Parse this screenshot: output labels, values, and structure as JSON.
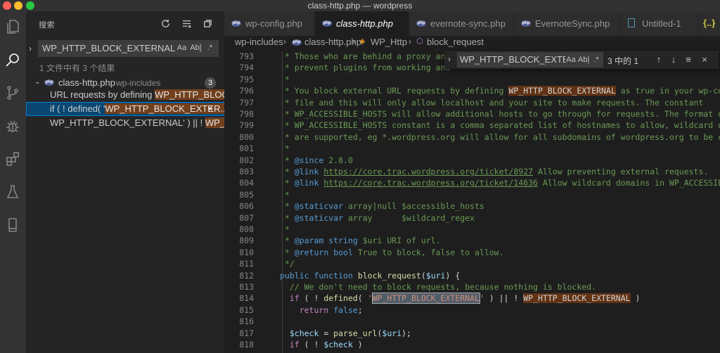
{
  "window": {
    "title": "class-http.php — wordpress"
  },
  "activity_bar": {
    "items": [
      {
        "icon": "files-icon"
      },
      {
        "icon": "search-icon"
      },
      {
        "icon": "source-control-icon"
      },
      {
        "icon": "debug-icon"
      },
      {
        "icon": "extensions-icon"
      },
      {
        "icon": "test-flask-icon"
      },
      {
        "icon": "device-icon"
      }
    ]
  },
  "sidebar": {
    "title": "搜索",
    "search_value": "WP_HTTP_BLOCK_EXTERNAL",
    "search_options": [
      "Aa",
      "Ab|",
      ".*"
    ],
    "result_summary": "1 文件中有 3 个结果",
    "file": {
      "name": "class-http.php",
      "path": "wp-includes",
      "count": "3",
      "badge": "php"
    },
    "matches": [
      {
        "before": "URL requests by defining ",
        "match": "WP_HTTP_BLOCK_...",
        "after": ""
      },
      {
        "before": "if ( ! defined( '",
        "match": "WP_HTTP_BLOCK_EXTER...",
        "after": ""
      },
      {
        "before": "WP_HTTP_BLOCK_EXTERNAL' ) || ! ",
        "match": "WP_HTTP...",
        "after": ""
      }
    ]
  },
  "tabs": [
    {
      "label": "wp-config.php",
      "type": "php"
    },
    {
      "label": "class-http.php",
      "type": "php",
      "active": true
    },
    {
      "label": "evernote-sync.php",
      "type": "php"
    },
    {
      "label": "EvernoteSync.php",
      "type": "php"
    },
    {
      "label": "Untitled-1",
      "type": "file"
    },
    {
      "label": "{..}",
      "type": "json"
    }
  ],
  "breadcrumbs": {
    "folder": "wp-includes",
    "file": "class-http.php",
    "class": "WP_Http",
    "method": "block_request"
  },
  "find_widget": {
    "value": "WP_HTTP_BLOCK_EXTERN/",
    "options": [
      "Aa",
      "Ab|",
      ".*"
    ],
    "count": "3 中的 1",
    "prev": "↑",
    "next": "↓",
    "selection": "≡",
    "close": "×"
  },
  "code": {
    "line_numbers": [
      "793",
      "794",
      "795",
      "796",
      "797",
      "798",
      "799",
      "800",
      "801",
      "802",
      "803",
      "804",
      "805",
      "806",
      "807",
      "808",
      "809",
      "810",
      "811",
      "812",
      "813",
      "814",
      "815",
      "816",
      "817",
      "818"
    ],
    "lines": [
      [
        {
          "c": "cm",
          "t": " * Those who are behind a proxy and "
        }
      ],
      [
        {
          "c": "cm",
          "t": " * prevent plugins from working and "
        }
      ],
      [
        {
          "c": "cm",
          "t": " *"
        }
      ],
      [
        {
          "c": "cm",
          "t": " * You block external URL requests by defining "
        },
        {
          "c": "mh",
          "t": "WP_HTTP_BLOCK_EXTERNAL"
        },
        {
          "c": "cm",
          "t": " as true in your wp-config"
        }
      ],
      [
        {
          "c": "cm",
          "t": " * file and this will only allow localhost and your site to make requests. The constant"
        }
      ],
      [
        {
          "c": "cm",
          "t": " * WP_ACCESSIBLE_HOSTS will allow additional hosts to go through for requests. The format of the"
        }
      ],
      [
        {
          "c": "cm",
          "t": " * WP_ACCESSIBLE_HOSTS constant is a comma separated list of hostnames to allow, wildcard domains"
        }
      ],
      [
        {
          "c": "cm",
          "t": " * are supported, eg *.wordpress.org will allow for all subdomains of wordpress.org to be contacted"
        }
      ],
      [
        {
          "c": "cm",
          "t": " *"
        }
      ],
      [
        {
          "c": "cm",
          "t": " * "
        },
        {
          "c": "tg",
          "t": "@since"
        },
        {
          "c": "cm",
          "t": " 2.8.0"
        }
      ],
      [
        {
          "c": "cm",
          "t": " * "
        },
        {
          "c": "tg",
          "t": "@link"
        },
        {
          "c": "cm",
          "t": " "
        },
        {
          "c": "lk",
          "t": "https://core.trac.wordpress.org/ticket/8927"
        },
        {
          "c": "cm",
          "t": " Allow preventing external requests."
        }
      ],
      [
        {
          "c": "cm",
          "t": " * "
        },
        {
          "c": "tg",
          "t": "@link"
        },
        {
          "c": "cm",
          "t": " "
        },
        {
          "c": "lk",
          "t": "https://core.trac.wordpress.org/ticket/14636"
        },
        {
          "c": "cm",
          "t": " Allow wildcard domains in WP_ACCESSIBLE_HOSTS"
        }
      ],
      [
        {
          "c": "cm",
          "t": " *"
        }
      ],
      [
        {
          "c": "cm",
          "t": " * "
        },
        {
          "c": "tg",
          "t": "@staticvar"
        },
        {
          "c": "cm",
          "t": " array|null $accessible_hosts"
        }
      ],
      [
        {
          "c": "cm",
          "t": " * "
        },
        {
          "c": "tg",
          "t": "@staticvar"
        },
        {
          "c": "cm",
          "t": " array      $wildcard_regex"
        }
      ],
      [
        {
          "c": "cm",
          "t": " *"
        }
      ],
      [
        {
          "c": "cm",
          "t": " * "
        },
        {
          "c": "tg",
          "t": "@param"
        },
        {
          "c": "cm",
          "t": " "
        },
        {
          "c": "tg",
          "t": "string"
        },
        {
          "c": "cm",
          "t": " $uri URI of url."
        }
      ],
      [
        {
          "c": "cm",
          "t": " * "
        },
        {
          "c": "tg",
          "t": "@return"
        },
        {
          "c": "cm",
          "t": " "
        },
        {
          "c": "tg",
          "t": "bool"
        },
        {
          "c": "cm",
          "t": " True to block, false to allow."
        }
      ],
      [
        {
          "c": "cm",
          "t": " */"
        }
      ],
      [
        {
          "c": "kw",
          "t": "public"
        },
        {
          "c": "",
          "t": " "
        },
        {
          "c": "kw",
          "t": "function"
        },
        {
          "c": "",
          "t": " "
        },
        {
          "c": "fn",
          "t": "block_request"
        },
        {
          "c": "",
          "t": "("
        },
        {
          "c": "vr",
          "t": "$uri"
        },
        {
          "c": "",
          "t": ") {"
        }
      ],
      [
        {
          "c": "cm",
          "t": "  // We don't need to block requests, because nothing is blocked."
        }
      ],
      [
        {
          "c": "kw2",
          "t": "  if"
        },
        {
          "c": "",
          "t": " ( ! "
        },
        {
          "c": "fn",
          "t": "defined"
        },
        {
          "c": "",
          "t": "( "
        },
        {
          "c": "str",
          "t": "'"
        },
        {
          "c": "mh-sel str",
          "t": "WP_HTTP_BLOCK_EXTERNAL"
        },
        {
          "c": "str",
          "t": "'"
        },
        {
          "c": "",
          "t": " ) || ! "
        },
        {
          "c": "mh",
          "t": "WP_HTTP_BLOCK_EXTERNAL"
        },
        {
          "c": "",
          "t": " )"
        }
      ],
      [
        {
          "c": "kw2",
          "t": "    return"
        },
        {
          "c": "",
          "t": " "
        },
        {
          "c": "kw",
          "t": "false"
        },
        {
          "c": "",
          "t": ";"
        }
      ],
      [
        {
          "c": "",
          "t": ""
        }
      ],
      [
        {
          "c": "vr",
          "t": "  $check"
        },
        {
          "c": "",
          "t": " = "
        },
        {
          "c": "fn",
          "t": "parse_url"
        },
        {
          "c": "",
          "t": "("
        },
        {
          "c": "vr",
          "t": "$uri"
        },
        {
          "c": "",
          "t": ");"
        }
      ],
      [
        {
          "c": "kw2",
          "t": "  if"
        },
        {
          "c": "",
          "t": " ( ! "
        },
        {
          "c": "vr",
          "t": "$check"
        },
        {
          "c": "",
          "t": " )"
        }
      ]
    ]
  }
}
